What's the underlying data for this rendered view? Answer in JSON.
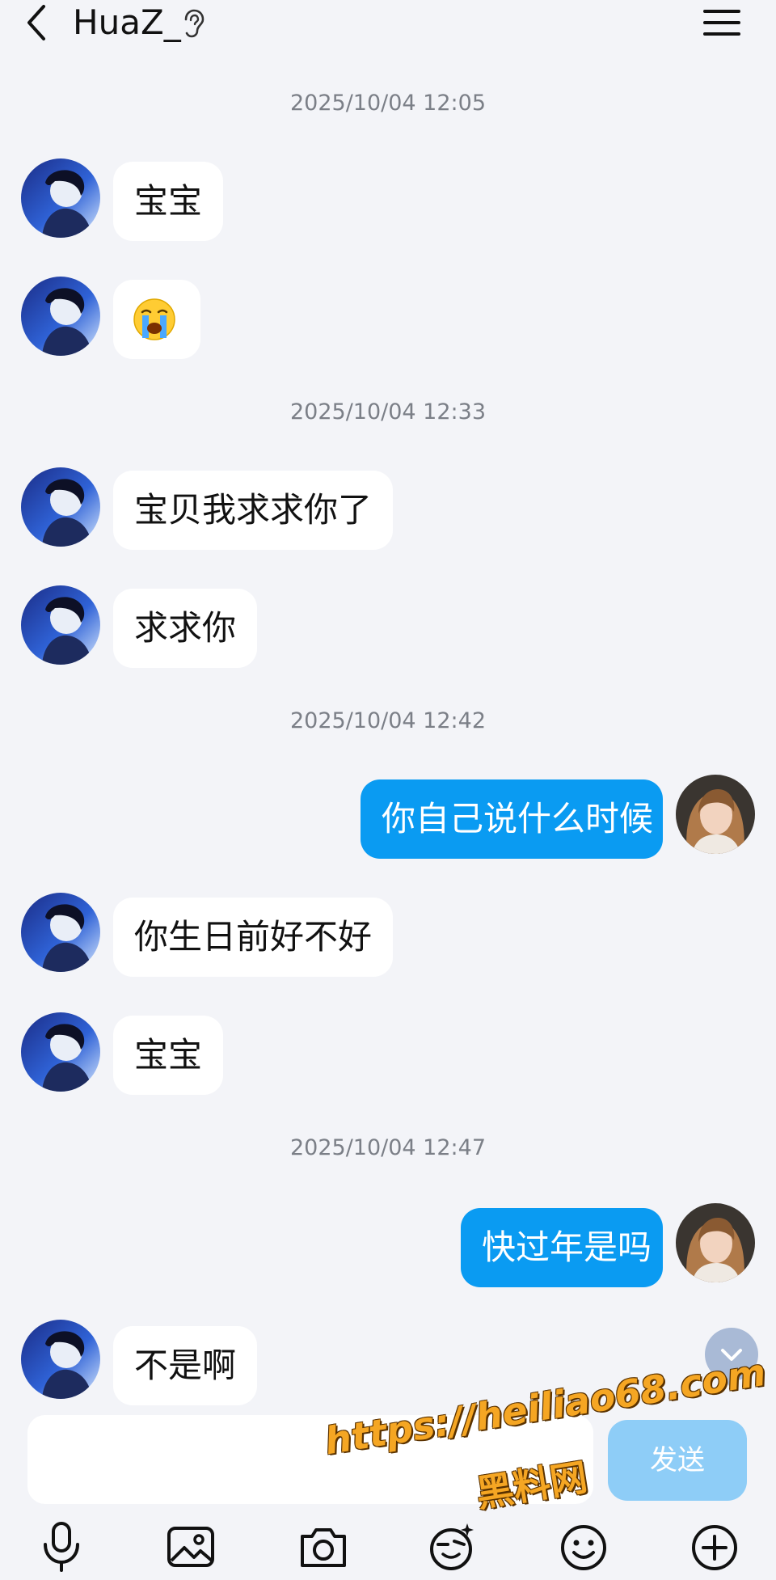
{
  "header": {
    "title": "HuaZ_",
    "back_icon": "chevron-left-icon",
    "status_icon": "ear-icon",
    "menu_icon": "hamburger-menu-icon"
  },
  "colors": {
    "background": "#f3f4f8",
    "incoming_bubble": "#ffffff",
    "outgoing_bubble": "#0a9bf2",
    "send_button": "#8ecdf7",
    "timestamp": "#7b7f87",
    "watermark": "#f5a623"
  },
  "messages": {
    "ts1": "2025/10/04 12:05",
    "m1": "宝宝",
    "m2_emoji": "loudly-crying-face-emoji",
    "ts2": "2025/10/04 12:33",
    "m3": "宝贝我求求你了",
    "m4": "求求你",
    "ts3": "2025/10/04 12:42",
    "m5": "你自己说什么时候",
    "m6": "你生日前好不好",
    "m7": "宝宝",
    "ts4": "2025/10/04 12:47",
    "m8": "快过年是吗",
    "m9": "不是啊"
  },
  "composer": {
    "send_label": "发送",
    "input_value": ""
  },
  "toolbar": {
    "icons": [
      "microphone-icon",
      "image-icon",
      "camera-icon",
      "face-sticker-icon",
      "smiley-icon",
      "plus-icon"
    ]
  },
  "watermark": {
    "line1": "https://heiliao68.com",
    "line2": "黑料网"
  }
}
